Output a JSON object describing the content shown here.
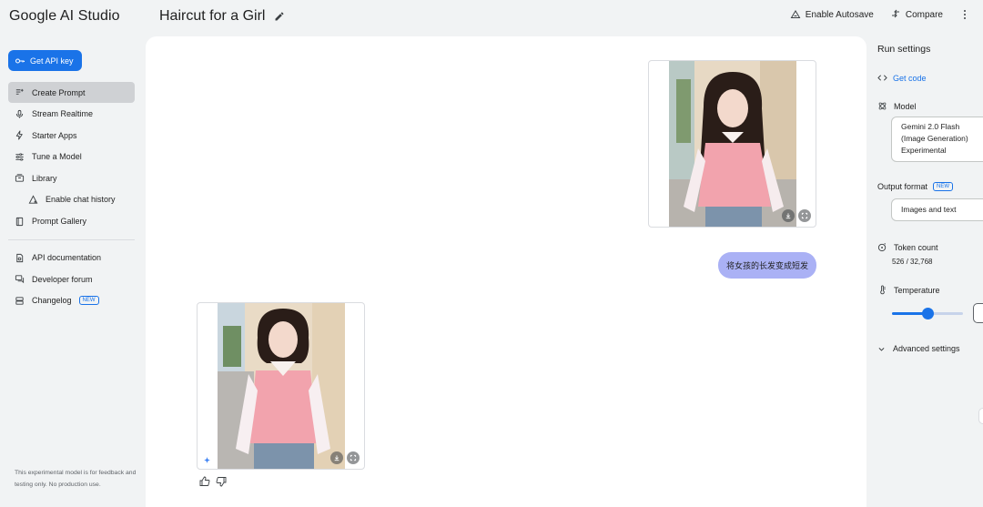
{
  "header": {
    "brand": "Google AI Studio",
    "title": "Haircut for a Girl",
    "autosave_label": "Enable Autosave",
    "compare_label": "Compare"
  },
  "sidebar": {
    "api_key_label": "Get API key",
    "items": [
      {
        "label": "Create Prompt",
        "icon": "create-prompt-icon",
        "active": true
      },
      {
        "label": "Stream Realtime",
        "icon": "microphone-icon"
      },
      {
        "label": "Starter Apps",
        "icon": "bolt-icon"
      },
      {
        "label": "Tune a Model",
        "icon": "tune-icon"
      },
      {
        "label": "Library",
        "icon": "library-icon"
      },
      {
        "label": "Enable chat history",
        "icon": "history-icon",
        "sub": true
      },
      {
        "label": "Prompt Gallery",
        "icon": "gallery-book-icon"
      }
    ],
    "links": [
      {
        "label": "API documentation",
        "icon": "docs-icon"
      },
      {
        "label": "Developer forum",
        "icon": "forum-icon"
      },
      {
        "label": "Changelog",
        "icon": "changelog-icon",
        "badge": "NEW"
      }
    ],
    "note": "This experimental model is for feedback and testing only. No production use."
  },
  "chat": {
    "user_message": "将女孩的长发变成短发"
  },
  "settings": {
    "title": "Run settings",
    "get_code_label": "Get code",
    "model_label": "Model",
    "model_value": "Gemini 2.0 Flash (Image Generation) Experimental",
    "output_format_label": "Output format",
    "output_format_badge": "NEW",
    "output_format_value": "Images and text",
    "token_label": "Token count",
    "token_value": "526 / 32,768",
    "temperature_label": "Temperature",
    "temperature_fraction": 0.5,
    "advanced_label": "Advanced settings"
  },
  "colors": {
    "accent": "#1a73e8",
    "user_bubble": "#aab1f5",
    "sweater_pink": "#f2a3ad"
  }
}
